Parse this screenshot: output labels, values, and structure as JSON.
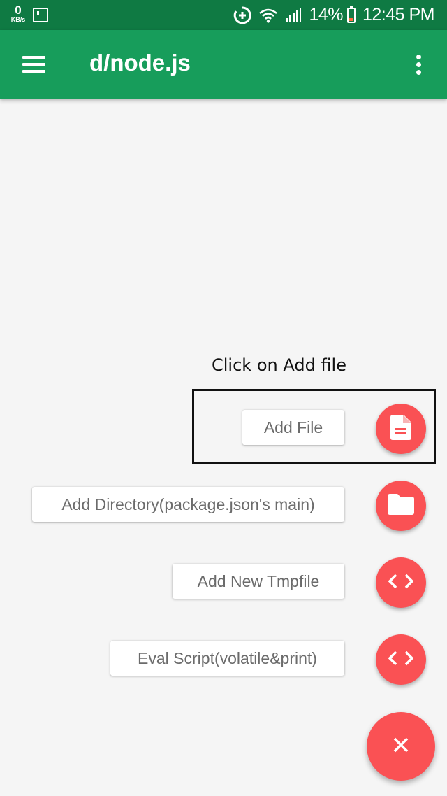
{
  "status_bar": {
    "net_speed": "0",
    "net_speed_unit": "KB/s",
    "battery_percent": "14%",
    "time": "12:45 PM",
    "icons": [
      "screen-icon",
      "data-saver-icon",
      "wifi-icon",
      "signal-icon",
      "battery-icon"
    ]
  },
  "app_bar": {
    "title": "d/node.js",
    "menu_icon": "hamburger-menu-icon",
    "overflow_icon": "more-vert-icon"
  },
  "annotation": {
    "hint": "Click on Add file"
  },
  "speed_dial": {
    "items": [
      {
        "label": "Add File",
        "icon": "file-icon"
      },
      {
        "label": "Add Directory(package.json's main)",
        "icon": "folder-icon"
      },
      {
        "label": "Add New Tmpfile",
        "icon": "code-icon"
      },
      {
        "label": "Eval Script(volatile&print)",
        "icon": "code-icon"
      }
    ],
    "close_icon": "close-icon"
  },
  "colors": {
    "status_bar": "#0f7a43",
    "app_bar": "#179d5b",
    "fab": "#fa5154",
    "background": "#f5f5f5"
  }
}
